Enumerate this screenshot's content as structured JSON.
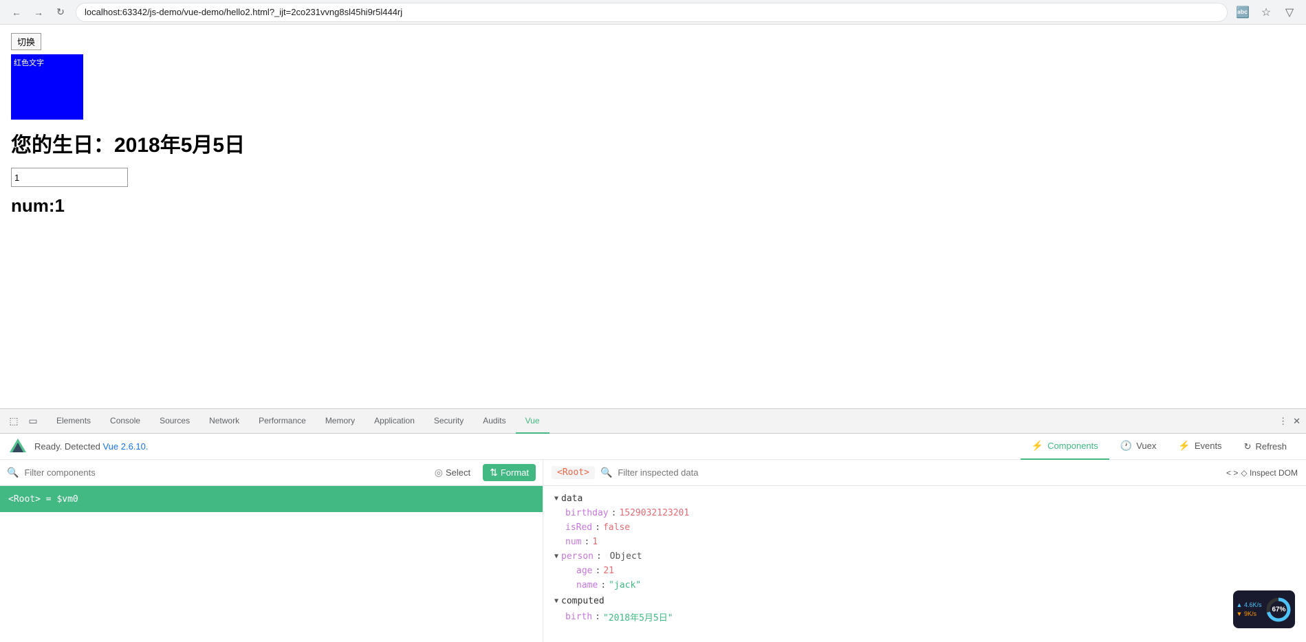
{
  "browser": {
    "url": "localhost:63342/js-demo/vue-demo/hello2.html?_ijt=2co231vvng8sl45hi9r5l444rj",
    "back_label": "←",
    "forward_label": "→",
    "reload_label": "↻"
  },
  "page": {
    "toggle_btn": "切换",
    "blue_box_text": "红色文字",
    "birthday_label": "您的生日：2018年5月5日",
    "input_value": "1",
    "num_display": "num:1"
  },
  "devtools": {
    "tabs": [
      {
        "label": "Elements",
        "active": false
      },
      {
        "label": "Console",
        "active": false
      },
      {
        "label": "Sources",
        "active": false
      },
      {
        "label": "Network",
        "active": false
      },
      {
        "label": "Performance",
        "active": false
      },
      {
        "label": "Memory",
        "active": false
      },
      {
        "label": "Application",
        "active": false
      },
      {
        "label": "Security",
        "active": false
      },
      {
        "label": "Audits",
        "active": false
      },
      {
        "label": "Vue",
        "active": true
      }
    ]
  },
  "vue_panel": {
    "ready_text": "Ready. Detected Vue 2.6.10.",
    "vue_version": "Vue 2.6.10.",
    "nav_tabs": [
      {
        "label": "Components",
        "icon": "⚡",
        "active": true
      },
      {
        "label": "Vuex",
        "icon": "🕐",
        "active": false
      },
      {
        "label": "Events",
        "icon": "⚡",
        "active": false
      }
    ],
    "refresh_label": "Refresh",
    "filter_placeholder": "Filter components",
    "select_label": "Select",
    "format_label": "Format",
    "component_label": "<Root>",
    "component_var": "$vm0",
    "root_tag": "<Root>",
    "filter_data_placeholder": "Filter inspected data",
    "inspect_dom_label": "◇ Inspect DOM",
    "data_tree": {
      "data_section": "data",
      "birthday_key": "birthday",
      "birthday_value": "1529032123201",
      "isRed_key": "isRed",
      "isRed_value": "false",
      "num_key": "num",
      "num_value": "1",
      "person_key": "person",
      "person_type": "Object",
      "age_key": "age",
      "age_value": "21",
      "name_key": "name",
      "name_value": "\"jack\"",
      "computed_section": "computed",
      "birth_key": "birth",
      "birth_value": "\"2018年5月5日\""
    }
  },
  "network_overlay": {
    "up_speed": "4.6K/s",
    "down_speed": "9K/s",
    "cpu_percent": "67%"
  }
}
